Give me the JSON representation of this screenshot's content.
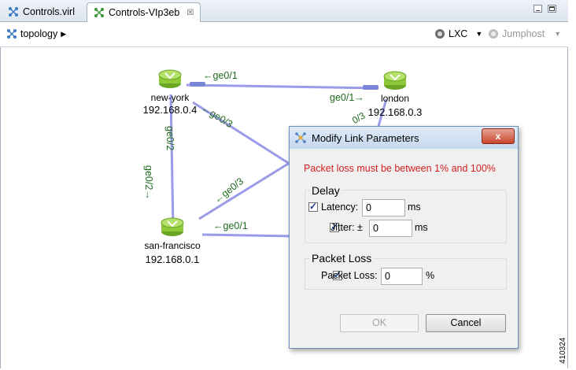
{
  "tabs": [
    {
      "label": "Controls.virl",
      "active": false
    },
    {
      "label": "Controls-VIp3eb",
      "active": true
    }
  ],
  "toolbar": {
    "topology_label": "topology",
    "lxc_label": "LXC",
    "jumphost_label": "Jumphost"
  },
  "nodes": {
    "new_york": {
      "name": "new-york",
      "ip": "192.168.0.4"
    },
    "london": {
      "name": "london",
      "ip": "192.168.0.3"
    },
    "san_francisco": {
      "name": "san-francisco",
      "ip": "192.168.0.1"
    }
  },
  "links": {
    "ny_london_ny_side": "←ge0/1",
    "ny_london_london_side": "ge0/1→",
    "ny_diag": "←ge0/3",
    "ny_sf_ny_side": "ge0/2",
    "ny_sf_sf_side": "ge0/2→",
    "sf_diag": "←ge0/3",
    "sf_right": "←ge0/1",
    "london_partial": "0/3"
  },
  "dialog": {
    "title": "Modify Link Parameters",
    "error": "Packet loss must be between 1% and 100%",
    "delay_group": "Delay",
    "latency_label": "Latency:",
    "latency_value": "0",
    "latency_unit": "ms",
    "jitter_label": "Jitter: ±",
    "jitter_value": "0",
    "jitter_unit": "ms",
    "packet_loss_group": "Packet Loss",
    "packet_loss_label": "Packet Loss:",
    "packet_loss_value": "0",
    "packet_loss_unit": "%",
    "ok_label": "OK",
    "cancel_label": "Cancel",
    "close_label": "x"
  },
  "figure_id": "410324",
  "colors": {
    "link": "#9b9bea",
    "label_green": "#1f6b1f",
    "router": "#8fc93a",
    "error": "#d21e1e"
  }
}
